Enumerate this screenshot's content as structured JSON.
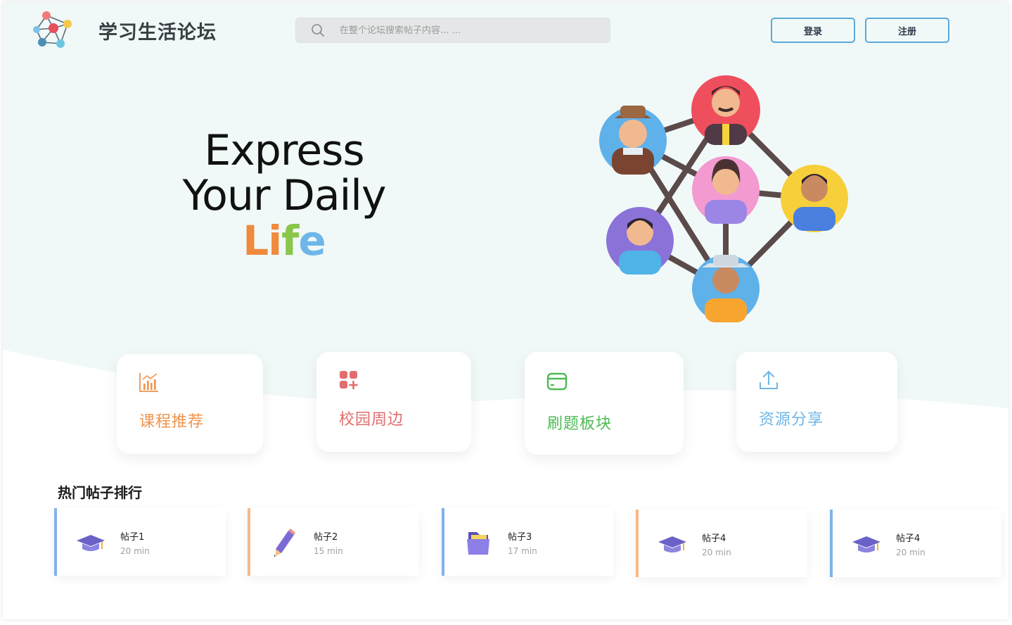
{
  "header": {
    "brand": "学习生活论坛",
    "search_placeholder": "在整个论坛搜索帖子内容... ...",
    "login_label": "登录",
    "register_label": "注册"
  },
  "hero": {
    "line1": "Express",
    "line2": "Your Daily",
    "line3_letters": [
      "L",
      "i",
      "f",
      "e"
    ],
    "line3_colors": [
      "#f08a3c",
      "#f08a3c",
      "#8ac64a",
      "#6fb6e8"
    ]
  },
  "categories": [
    {
      "label": "课程推荐",
      "icon": "bar-chart-icon",
      "color": "#f0934b"
    },
    {
      "label": "校园周边",
      "icon": "apps-add-icon",
      "color": "#e26d6d"
    },
    {
      "label": "刷题板块",
      "icon": "card-icon",
      "color": "#4cbb55"
    },
    {
      "label": "资源分享",
      "icon": "upload-icon",
      "color": "#6fb6e8"
    }
  ],
  "hot_posts": {
    "title": "热门帖子排行",
    "items": [
      {
        "title": "帖子1",
        "meta": "20 min",
        "icon": "graduation-cap-icon",
        "accent": "#7fb3ea"
      },
      {
        "title": "帖子2",
        "meta": "15 min",
        "icon": "pencil-icon",
        "accent": "#f4b98a"
      },
      {
        "title": "帖子3",
        "meta": "17 min",
        "icon": "folder-icon",
        "accent": "#7fb3ea"
      },
      {
        "title": "帖子4",
        "meta": "20 min",
        "icon": "graduation-cap-icon",
        "accent": "#f4b98a"
      },
      {
        "title": "帖子4",
        "meta": "20 min",
        "icon": "graduation-cap-icon",
        "accent": "#7fb3ea"
      }
    ]
  },
  "colors": {
    "hero_bg": "#f0f9f8",
    "button_border": "#5aa9d8"
  }
}
